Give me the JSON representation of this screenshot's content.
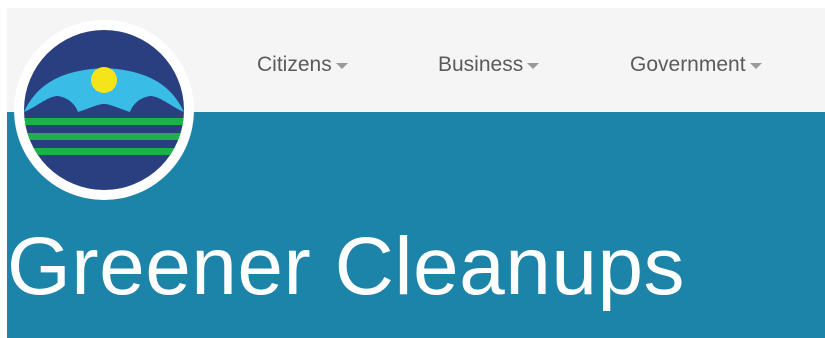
{
  "header": {
    "nav_items": [
      {
        "label": "Citizens"
      },
      {
        "label": "Business"
      },
      {
        "label": "Government"
      }
    ]
  },
  "hero": {
    "title": "Greener Cleanups"
  },
  "logo": {
    "icon": "sun-over-hills-logo-icon"
  },
  "colors": {
    "navbar_bg": "#f5f5f5",
    "hero_bg": "#1c83a9",
    "logo_navy": "#2a3f80",
    "logo_sky": "#39bde6",
    "logo_sun": "#f6e41a",
    "logo_green": "#1eb14b",
    "nav_text": "#5b5b5b"
  }
}
